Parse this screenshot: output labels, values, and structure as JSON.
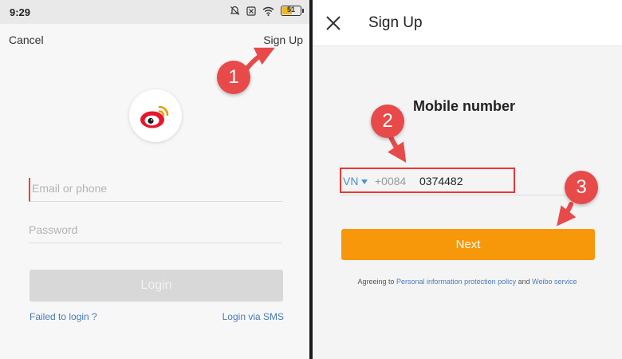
{
  "left": {
    "status_bar": {
      "time": "9:29",
      "battery": "51"
    },
    "cancel_label": "Cancel",
    "signup_label": "Sign Up",
    "email_placeholder": "Email or phone",
    "password_placeholder": "Password",
    "login_label": "Login",
    "failed_label": "Failed to login ?",
    "sms_label": "Login via SMS"
  },
  "right": {
    "title": "Sign Up",
    "heading": "Mobile number",
    "country": "VN",
    "dial_code": "+0084",
    "phone_value": "0374482",
    "next_label": "Next",
    "terms_prefix": "Agreeing to",
    "terms_link1": "Personal information protection policy",
    "terms_and": "and",
    "terms_link2": "Weibo service"
  },
  "annotations": {
    "step1": "1",
    "step2": "2",
    "step3": "3"
  },
  "colors": {
    "accent": "#f7970a",
    "marker": "#e84a4a",
    "link": "#4a7bbf",
    "highlight": "#e53935"
  }
}
